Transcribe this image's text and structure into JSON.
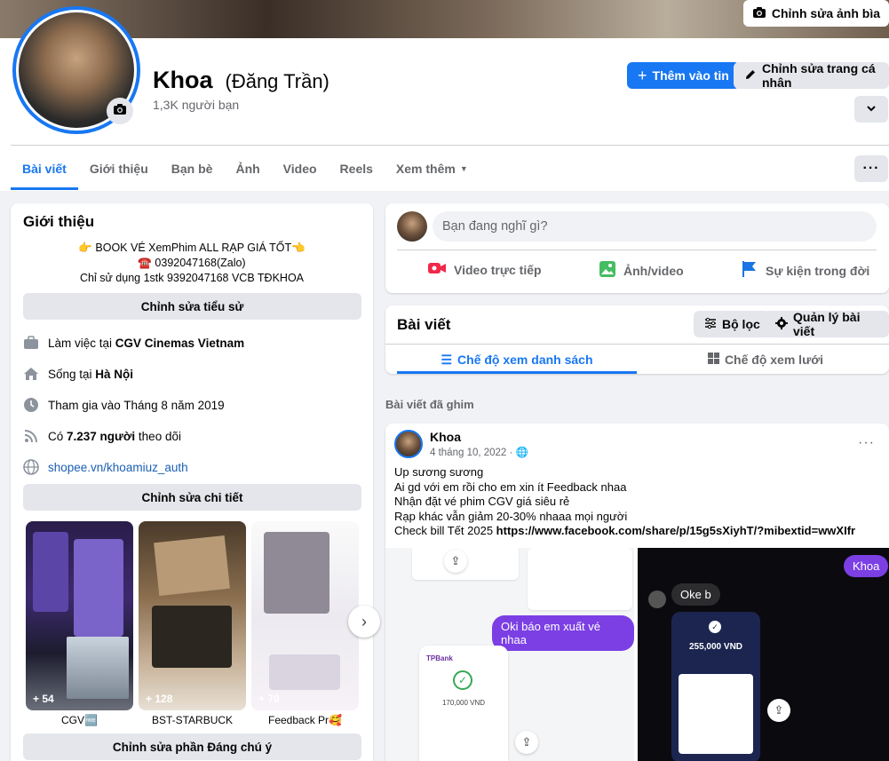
{
  "cover": {
    "edit_label": "Chỉnh sửa ảnh bìa"
  },
  "profile": {
    "name": "Khoa",
    "alt_name": "(Đăng Trần)",
    "friends": "1,3K người bạn"
  },
  "actions": {
    "add_story": "Thêm vào tin",
    "edit_profile": "Chỉnh sửa trang cá nhân"
  },
  "tabs": [
    "Bài viết",
    "Giới thiệu",
    "Bạn bè",
    "Ảnh",
    "Video",
    "Reels",
    "Xem thêm"
  ],
  "intro": {
    "title": "Giới thiệu",
    "bio": [
      "👉 BOOK VÉ XemPhim ALL RẠP GIÁ TỐT👈",
      "☎️ 0392047168(Zalo)",
      "Chỉ sử dụng 1stk 9392047168 VCB TĐKHOA"
    ],
    "edit_bio": "Chỉnh sửa tiểu sử",
    "work_prefix": "Làm việc tại ",
    "work": "CGV Cinemas Vietnam",
    "lives_prefix": "Sống tại ",
    "lives": "Hà Nội",
    "joined": "Tham gia vào Tháng 8 năm 2019",
    "followers_prefix": "Có ",
    "followers": "7.237 người",
    "followers_suffix": " theo dõi",
    "website": "shopee.vn/khoamiuz_auth",
    "edit_details": "Chỉnh sửa chi tiết",
    "featured": [
      {
        "label": "CGV🆓",
        "count": "+ 54"
      },
      {
        "label": "BST-STARBUCK",
        "count": "+ 128"
      },
      {
        "label": "Feedback Pr🥰",
        "count": "+ 70"
      }
    ],
    "edit_featured": "Chỉnh sửa phần Đáng chú ý"
  },
  "composer": {
    "placeholder": "Bạn đang nghĩ gì?",
    "live": "Video trực tiếp",
    "photo": "Ảnh/video",
    "event": "Sự kiện trong đời"
  },
  "posts": {
    "title": "Bài viết",
    "filter": "Bộ lọc",
    "manage": "Quản lý bài viết",
    "list_view": "Chế độ xem danh sách",
    "grid_view": "Chế độ xem lưới",
    "pinned": "Bài viết đã ghim"
  },
  "post": {
    "author": "Khoa",
    "date": "4 tháng 10, 2022 · 🌐",
    "lines": [
      "Up sương sương",
      "Ai gd với em rồi cho em xin ít Feedback nhaa",
      "Nhận đặt vé phim CGV giá siêu rẻ",
      "Rạp khác vẫn giảm 20-30% nhaaa mọi người"
    ],
    "bill_prefix": "Check bill Tết 2025 ",
    "bill_url": "https://www.facebook.com/share/p/15g5sXiyhT/?mibextid=wwXIfr",
    "photo_left": {
      "bubble": "Oki báo em xuất vé nhaa",
      "amount": "170,000 VND",
      "bank": "TPBank"
    },
    "photo_right": {
      "bubble_me": "Khoa",
      "bubble_other": "Oke b",
      "amount": "255,000 VND"
    }
  },
  "colors": {
    "accent": "#1877f2",
    "bg": "#f0f2f5"
  }
}
